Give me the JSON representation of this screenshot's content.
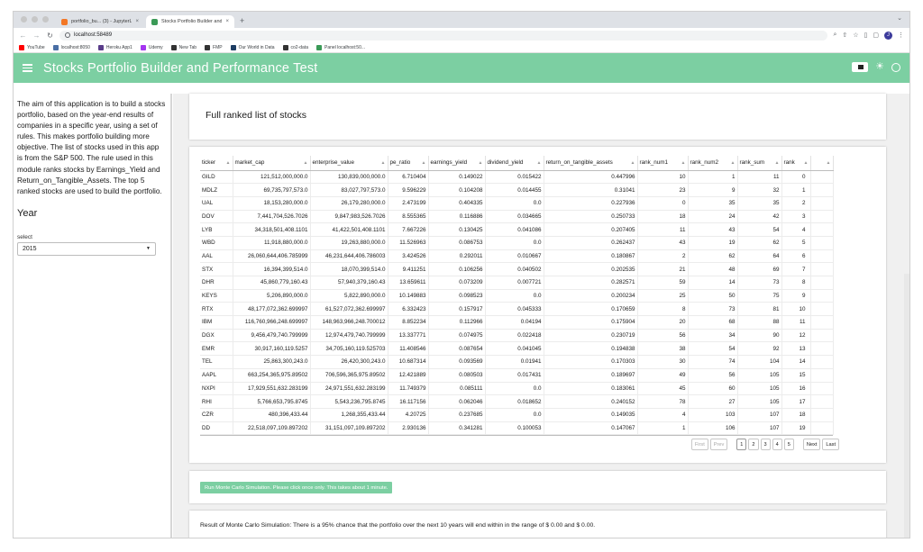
{
  "browser": {
    "tabs": [
      {
        "title": "portfolio_bu... (3) - JupyterLab",
        "favicon_color": "#f37726",
        "active": false
      },
      {
        "title": "Stocks Portfolio Builder and Pe",
        "favicon_color": "#3b9a57",
        "active": true
      }
    ],
    "new_tab": "+",
    "url": "localhost:58489",
    "profile_initial": "J",
    "bookmarks": [
      {
        "label": "YouTube",
        "color": "#ff0000"
      },
      {
        "label": "localhost:8050",
        "color": "#4a6fa5"
      },
      {
        "label": "Heroku App1",
        "color": "#5a3d8a"
      },
      {
        "label": "Udemy",
        "color": "#a435f0"
      },
      {
        "label": "New Tab",
        "color": "#333333"
      },
      {
        "label": "FMP",
        "color": "#333333"
      },
      {
        "label": "Our World in Data",
        "color": "#1d3d63"
      },
      {
        "label": "co2-data",
        "color": "#333333"
      },
      {
        "label": "Panel localhost:50...",
        "color": "#3b9a57"
      }
    ]
  },
  "header": {
    "title": "Stocks Portfolio Builder and Performance Test",
    "accent": "#7ccfa2"
  },
  "sidebar": {
    "description": "The aim of this application is to build a stocks portfolio, based on the year-end results of companies in a specific year, using a set of rules. This makes portfolio building more objective. The list of stocks used in this app is from the S&P 500. The rule used in this module ranks stocks by Earnings_Yield and Return_on_Tangible_Assets. The top 5 ranked stocks are used to build the portfolio.",
    "heading": "Year",
    "select_label": "select",
    "select_value": "2015"
  },
  "main": {
    "list_title": "Full ranked list of stocks",
    "table": {
      "columns": [
        "ticker",
        "market_cap",
        "enterprise_value",
        "pe_ratio",
        "earnings_yield",
        "dividend_yield",
        "return_on_tangible_assets",
        "rank_num1",
        "rank_num2",
        "rank_sum",
        "rank",
        ""
      ],
      "rows": [
        [
          "GILD",
          "121,512,000,000.0",
          "130,839,000,000.0",
          "6.710404",
          "0.149022",
          "0.015422",
          "0.447996",
          "10",
          "1",
          "11",
          "0"
        ],
        [
          "MDLZ",
          "69,735,797,573.0",
          "83,027,797,573.0",
          "9.596229",
          "0.104208",
          "0.014455",
          "0.31041",
          "23",
          "9",
          "32",
          "1"
        ],
        [
          "UAL",
          "18,153,280,000.0",
          "26,179,280,000.0",
          "2.473199",
          "0.404335",
          "0.0",
          "0.227936",
          "0",
          "35",
          "35",
          "2"
        ],
        [
          "DOV",
          "7,441,704,526.7026",
          "9,847,983,526.7026",
          "8.555365",
          "0.116886",
          "0.034665",
          "0.250733",
          "18",
          "24",
          "42",
          "3"
        ],
        [
          "LYB",
          "34,318,501,408.1101",
          "41,422,501,408.1101",
          "7.667226",
          "0.130425",
          "0.041086",
          "0.207405",
          "11",
          "43",
          "54",
          "4"
        ],
        [
          "WBD",
          "11,918,880,000.0",
          "19,263,880,000.0",
          "11.526963",
          "0.086753",
          "0.0",
          "0.262437",
          "43",
          "19",
          "62",
          "5"
        ],
        [
          "AAL",
          "26,060,644,406.785999",
          "46,231,644,406.786003",
          "3.424526",
          "0.292011",
          "0.010667",
          "0.180867",
          "2",
          "62",
          "64",
          "6"
        ],
        [
          "STX",
          "16,394,399,514.0",
          "18,070,399,514.0",
          "9.411251",
          "0.106256",
          "0.040502",
          "0.202535",
          "21",
          "48",
          "69",
          "7"
        ],
        [
          "DHR",
          "45,860,779,160.43",
          "57,940,379,160.43",
          "13.659611",
          "0.073209",
          "0.007721",
          "0.282571",
          "59",
          "14",
          "73",
          "8"
        ],
        [
          "KEYS",
          "5,206,890,000.0",
          "5,822,890,000.0",
          "10.149883",
          "0.098523",
          "0.0",
          "0.200234",
          "25",
          "50",
          "75",
          "9"
        ],
        [
          "RTX",
          "48,177,072,362.699997",
          "61,527,072,362.699997",
          "6.332423",
          "0.157917",
          "0.045333",
          "0.170659",
          "8",
          "73",
          "81",
          "10"
        ],
        [
          "IBM",
          "116,760,966,248.699997",
          "148,963,966,248.700012",
          "8.852234",
          "0.112966",
          "0.04194",
          "0.175904",
          "20",
          "68",
          "88",
          "11"
        ],
        [
          "DGX",
          "9,456,479,740.799999",
          "12,974,479,740.799999",
          "13.337771",
          "0.074975",
          "0.022418",
          "0.230719",
          "56",
          "34",
          "90",
          "12"
        ],
        [
          "EMR",
          "30,917,160,119.5257",
          "34,705,160,119.525703",
          "11.408546",
          "0.087654",
          "0.041045",
          "0.194838",
          "38",
          "54",
          "92",
          "13"
        ],
        [
          "TEL",
          "25,863,300,243.0",
          "26,420,300,243.0",
          "10.687314",
          "0.093569",
          "0.01941",
          "0.170303",
          "30",
          "74",
          "104",
          "14"
        ],
        [
          "AAPL",
          "663,254,365,975.89502",
          "706,596,365,975.89502",
          "12.421889",
          "0.080503",
          "0.017431",
          "0.189697",
          "49",
          "56",
          "105",
          "15"
        ],
        [
          "NXPI",
          "17,929,551,632.283199",
          "24,971,551,632.283199",
          "11.749379",
          "0.085111",
          "0.0",
          "0.183061",
          "45",
          "60",
          "105",
          "16"
        ],
        [
          "RHI",
          "5,766,653,795.8745",
          "5,543,236,795.8745",
          "16.117156",
          "0.062046",
          "0.018652",
          "0.240152",
          "78",
          "27",
          "105",
          "17"
        ],
        [
          "CZR",
          "480,396,433.44",
          "1,268,355,433.44",
          "4.20725",
          "0.237685",
          "0.0",
          "0.149035",
          "4",
          "103",
          "107",
          "18"
        ],
        [
          "DD",
          "22,518,097,109.897202",
          "31,151,097,109.897202",
          "2.930136",
          "0.341281",
          "0.100053",
          "0.147067",
          "1",
          "106",
          "107",
          "19"
        ]
      ]
    },
    "pagination": {
      "first": "First",
      "prev": "Prev",
      "pages": [
        "1",
        "2",
        "3",
        "4",
        "5"
      ],
      "current": "1",
      "next": "Next",
      "last": "Last"
    },
    "run_button": "Run Monte Carlo Simulation. Please click once only. This takes about 1 minute.",
    "result_text": "Result of Monte Carlo Simulation: There is a 95% chance that the portfolio over the next 10 years will end within in the range of $ 0.00 and $ 0.00."
  }
}
